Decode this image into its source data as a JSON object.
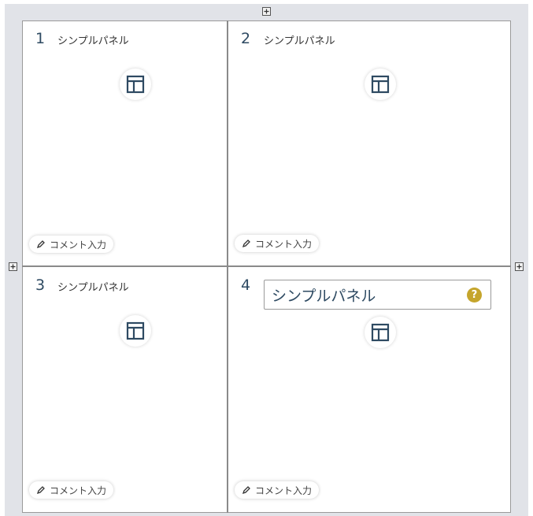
{
  "colors": {
    "accent": "#2e4a62",
    "help": "#c5a52c",
    "canvas": "#e1e3e8"
  },
  "panels": [
    {
      "number": "1",
      "title": "シンプルパネル",
      "comment_label": "コメント入力",
      "icon": "layout-icon"
    },
    {
      "number": "2",
      "title": "シンプルパネル",
      "comment_label": "コメント入力",
      "icon": "layout-icon"
    },
    {
      "number": "3",
      "title": "シンプルパネル",
      "comment_label": "コメント入力",
      "icon": "layout-icon"
    },
    {
      "number": "4",
      "title": "シンプルパネル",
      "comment_label": "コメント入力",
      "icon": "layout-icon",
      "editing": true,
      "help": "?"
    }
  ],
  "add_buttons": [
    "add-row-top",
    "add-column-left",
    "add-column-right"
  ]
}
